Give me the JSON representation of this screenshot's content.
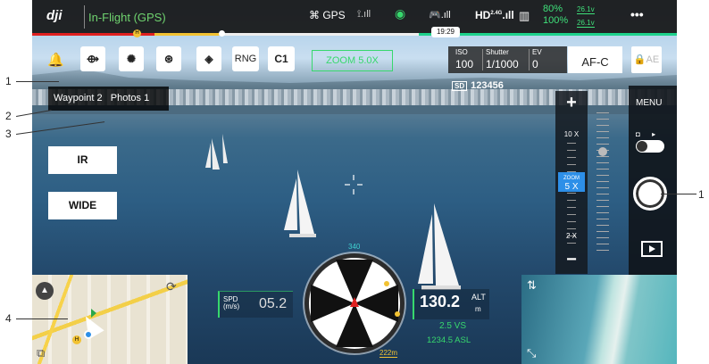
{
  "callouts": [
    "1",
    "2",
    "3",
    "4",
    "1"
  ],
  "topbar": {
    "brand": "dji",
    "flight_mode": "In-Flight (GPS)",
    "gps_label": "GPS",
    "hd_label": "HD",
    "hd_band": "2.4G",
    "battery_pct_1": "80%",
    "battery_pct_2": "100%",
    "battery_volt_1": "26.1v",
    "battery_volt_2": "26.1v",
    "menu_dots": "•••",
    "time": "19:29",
    "progress": 0.6
  },
  "toolbar": {
    "rng_label": "RNG",
    "c1_label": "C1",
    "zoom_badge": "ZOOM 5.0X"
  },
  "camera": {
    "iso_label": "ISO",
    "iso_value": "100",
    "shutter_label": "Shutter",
    "shutter_value": "1/1000",
    "ev_label": "EV",
    "ev_value": "0",
    "af_mode": "AF-C",
    "ae_label": "AE",
    "serial": "123456"
  },
  "waypoint": {
    "text": "Waypoint 2",
    "photos": "Photos 1"
  },
  "modes": {
    "ir": "IR",
    "wide": "WIDE"
  },
  "zoom": {
    "max": "10 X",
    "current_label": "ZOOM",
    "current": "5 X",
    "min": "2 X",
    "plus": "+",
    "minus": "−"
  },
  "rightpanel": {
    "menu": "MENU"
  },
  "telemetry": {
    "spd_label": "SPD",
    "spd_unit": "(m/s)",
    "spd_value": "05.2",
    "alt_value": "130.2",
    "alt_label": "ALT",
    "alt_unit": "m",
    "vs": "2.5 VS",
    "asl": "1234.5 ASL",
    "heading": "340",
    "distance": "222m"
  },
  "colors": {
    "accent_green": "#37d86d",
    "zoom_blue": "#2d8fe8",
    "home_yellow": "#f2c232",
    "warning_red": "#e02020"
  }
}
